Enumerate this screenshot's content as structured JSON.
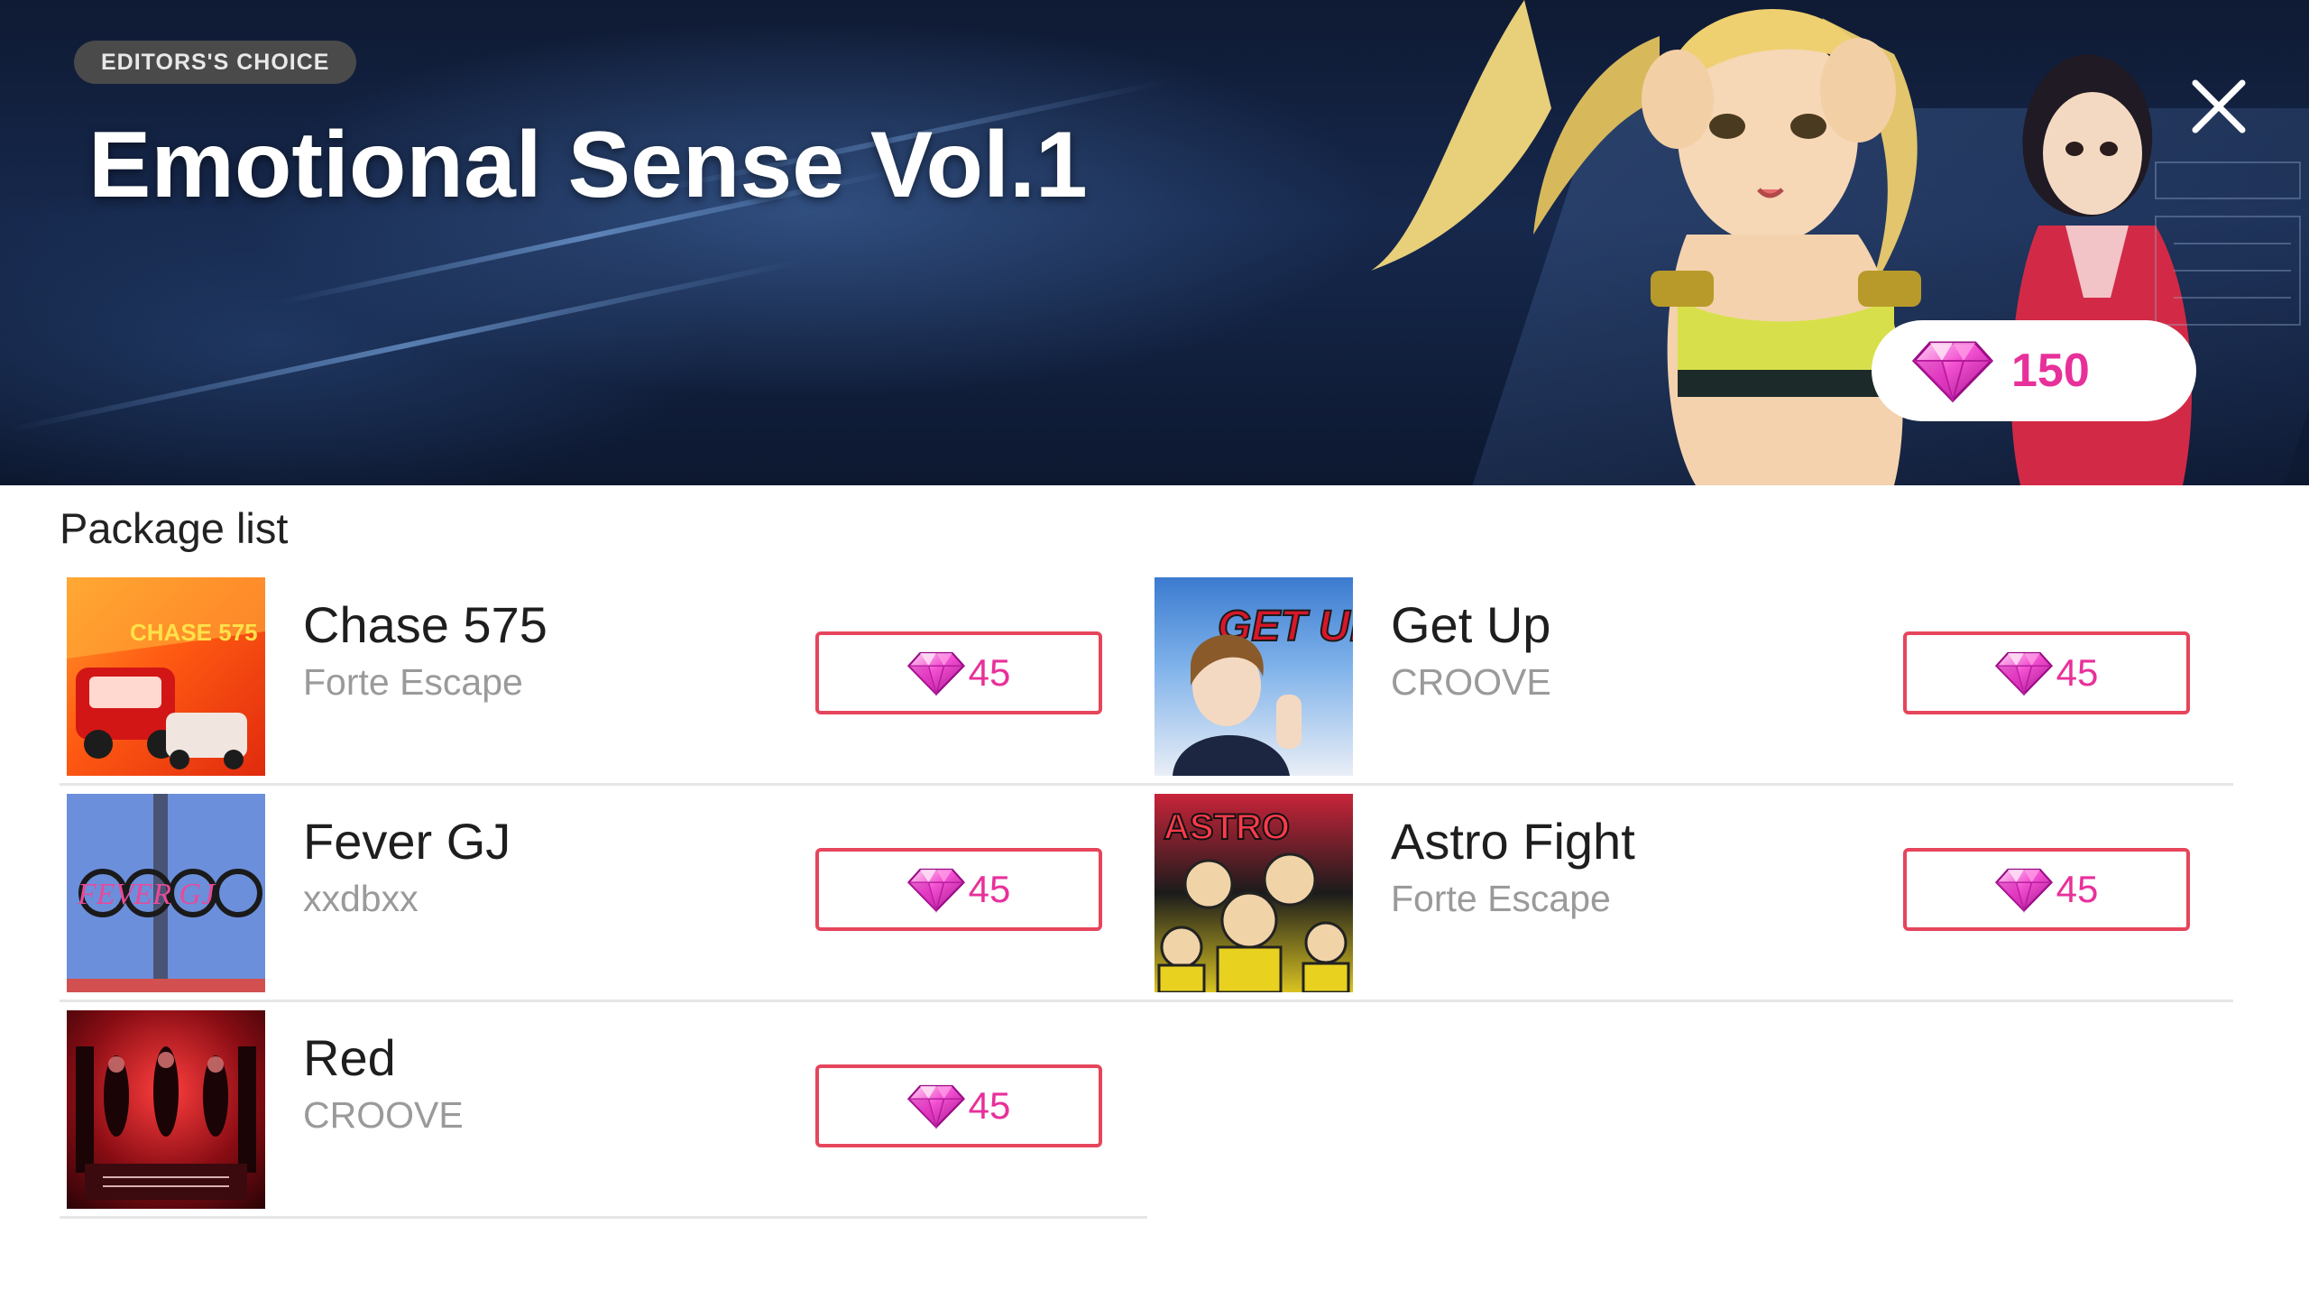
{
  "header": {
    "badge": "EDITORS'S CHOICE",
    "title": "Emotional Sense Vol.1",
    "package_price": "150",
    "close_icon": "close-icon",
    "currency_icon": "diamond-gem-icon"
  },
  "list": {
    "heading": "Package list",
    "items": [
      {
        "name": "Chase 575",
        "artist": "Forte Escape",
        "price": "45"
      },
      {
        "name": "Get Up",
        "artist": "CROOVE",
        "price": "45"
      },
      {
        "name": "Fever GJ",
        "artist": "xxdbxx",
        "price": "45"
      },
      {
        "name": "Astro Fight",
        "artist": "Forte Escape",
        "price": "45"
      },
      {
        "name": "Red",
        "artist": "CROOVE",
        "price": "45"
      }
    ]
  },
  "colors": {
    "accent": "#e8309a",
    "buy_border": "#e6455c",
    "badge_bg": "#4a4a4a"
  }
}
